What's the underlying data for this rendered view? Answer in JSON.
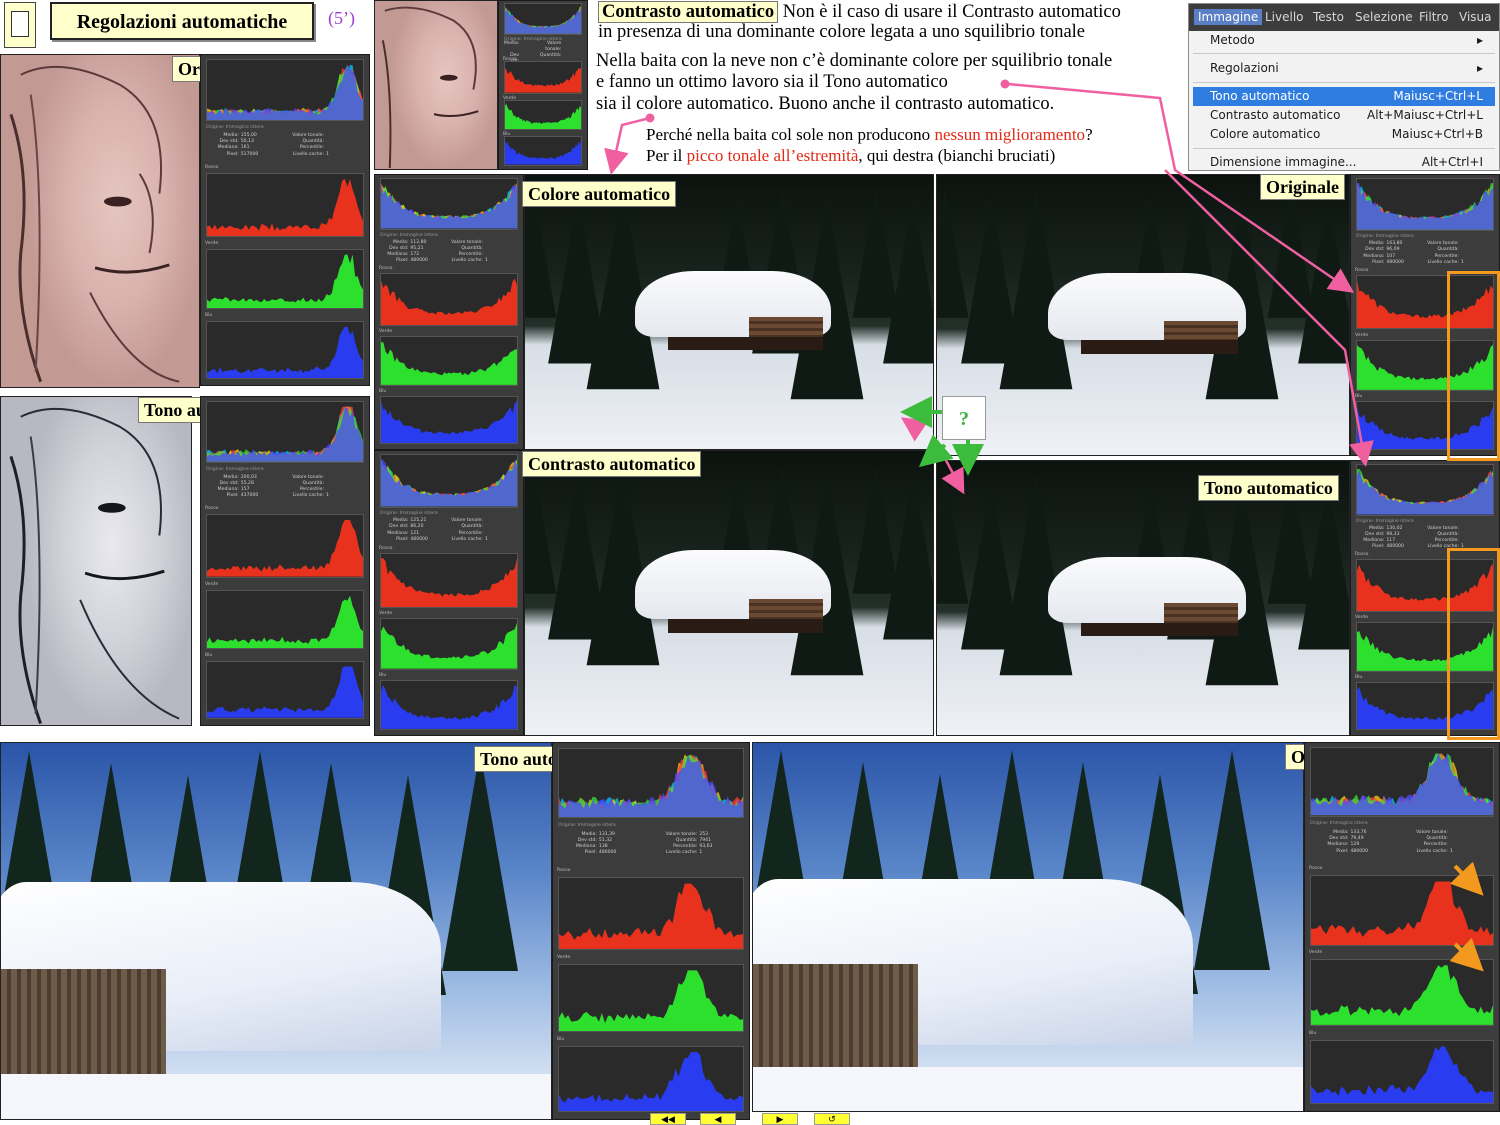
{
  "header": {
    "title": "Regolazioni automatiche",
    "duration": "(5’)"
  },
  "labels": {
    "originale": "Originale",
    "tono": "Tono automatico",
    "colore": "Colore automatico",
    "contrasto": "Contrasto automatico",
    "question": "?"
  },
  "notes": {
    "contrasto_title": "Contrasto automatico",
    "line1_rest": " Non è il caso di usare il Contrasto automatico",
    "line2": "in presenza di una dominante colore legata a uno squilibrio tonale",
    "line3": "Nella baita con la neve non c’è dominante colore per squilibrio tonale",
    "line4": "e fanno un ottimo lavoro sia il Tono automatico",
    "line5": "sia il colore automatico. Buono anche il contrasto automatico.",
    "line6_a": "Perché nella baita col sole non producono ",
    "line6_red": "nessun miglioramento",
    "line6_b": "?",
    "line7_a": "Per il ",
    "line7_red": "picco tonale all’estremità",
    "line7_b": ", qui destra (bianchi bruciati)"
  },
  "menu": {
    "bar": [
      "Immagine",
      "Livello",
      "Testo",
      "Selezione",
      "Filtro",
      "Visua"
    ],
    "items": [
      {
        "label": "Metodo",
        "shortcut": "▸"
      },
      {
        "label": "Regolazioni",
        "shortcut": "▸"
      },
      {
        "label": "Tono automatico",
        "shortcut": "Maiusc+Ctrl+L"
      },
      {
        "label": "Contrasto automatico",
        "shortcut": "Alt+Maiusc+Ctrl+L"
      },
      {
        "label": "Colore automatico",
        "shortcut": "Maiusc+Ctrl+B"
      },
      {
        "label": "Dimensione immagine...",
        "shortcut": "Alt+Ctrl+I"
      }
    ]
  },
  "hist": {
    "tabs": "Origine:   Immagine intera",
    "red": "Rosso",
    "green": "Verde",
    "blue": "Blu",
    "keys": [
      "Media:",
      "Dev std:",
      "Mediana:",
      "Pixel:"
    ],
    "keys2": [
      "Valore tonale:",
      "Quantità:",
      "Percentile:",
      "Livello cache:"
    ],
    "p_orig_face": {
      "v": [
        "155,00",
        "50,13",
        "161",
        "517000"
      ],
      "v2": [
        "",
        "",
        "",
        "1"
      ]
    },
    "p_tono_face": {
      "v": [
        "200,03",
        "55,28",
        "157",
        "437000"
      ],
      "v2": [
        "",
        "",
        "",
        "1"
      ]
    },
    "p_colore": {
      "v": [
        "112,80",
        "95,21",
        "172",
        "480000"
      ],
      "v2": [
        "",
        "",
        "",
        "1"
      ]
    },
    "p_contrasto": {
      "v": [
        "125,21",
        "86,20",
        "121",
        "480000"
      ],
      "v2": [
        "",
        "",
        "",
        "1"
      ]
    },
    "p_orig_snow": {
      "v": [
        "163,80",
        "96,09",
        "107",
        "480000"
      ],
      "v2": [
        "",
        "",
        "",
        "1"
      ]
    },
    "p_tono_snow": {
      "v": [
        "130,02",
        "98,33",
        "117",
        "480000"
      ],
      "v2": [
        "",
        "",
        "",
        "1"
      ]
    },
    "p_tono_sun": {
      "v": [
        "131,39",
        "51,32",
        "138",
        "480000"
      ],
      "v2": [
        "253",
        "7941",
        "93,63",
        "1"
      ]
    },
    "p_orig_sun": {
      "v": [
        "133,76",
        "79,49",
        "129",
        "480000"
      ],
      "v2": [
        "",
        "",
        "",
        "1"
      ]
    }
  },
  "nav": [
    "◀◀",
    "◀",
    "▶",
    "↺"
  ]
}
